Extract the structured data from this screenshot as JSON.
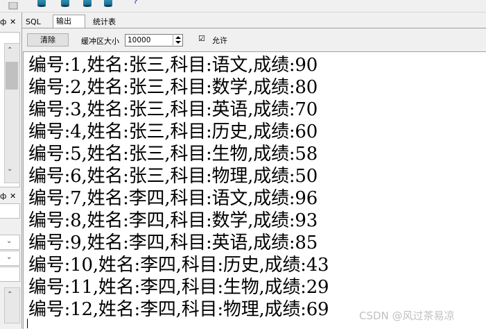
{
  "tabs": [
    {
      "label": "SQL"
    },
    {
      "label": "输出"
    },
    {
      "label": "统计表"
    }
  ],
  "toolbar": {
    "clear_label": "清除",
    "buffer_label": "缓冲区大小",
    "buffer_value": "10000",
    "allow_label": "允许",
    "help_glyph": "?"
  },
  "left_panel": {
    "pin_label_1": "ф",
    "pin_label_2": "ф"
  },
  "output_lines": [
    "编号:1,姓名:张三,科目:语文,成绩:90",
    "编号:2,姓名:张三,科目:数学,成绩:80",
    "编号:3,姓名:张三,科目:英语,成绩:70",
    "编号:4,姓名:张三,科目:历史,成绩:60",
    "编号:5,姓名:张三,科目:生物,成绩:58",
    "编号:6,姓名:张三,科目:物理,成绩:50",
    "编号:7,姓名:李四,科目:语文,成绩:96",
    "编号:8,姓名:李四,科目:数学,成绩:93",
    "编号:9,姓名:李四,科目:英语,成绩:85",
    "编号:10,姓名:李四,科目:历史,成绩:43",
    "编号:11,姓名:李四,科目:生物,成绩:29",
    "编号:12,姓名:李四,科目:物理,成绩:69"
  ],
  "watermark": "CSDN @风过茶易凉"
}
